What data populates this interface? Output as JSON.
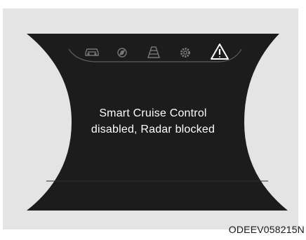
{
  "message": {
    "line1": "Smart Cruise Control",
    "line2": "disabled, Radar blocked"
  },
  "figure_code": "ODEEV058215N",
  "icons": [
    "car-icon",
    "compass-icon",
    "road-icon",
    "gear-icon",
    "warning-triangle-icon"
  ],
  "colors": {
    "display_bg": "#1c1c1c",
    "icon_gray": "#777777",
    "icon_active": "#ffffff",
    "text": "#ffffff",
    "background": "#e4e4e4"
  }
}
